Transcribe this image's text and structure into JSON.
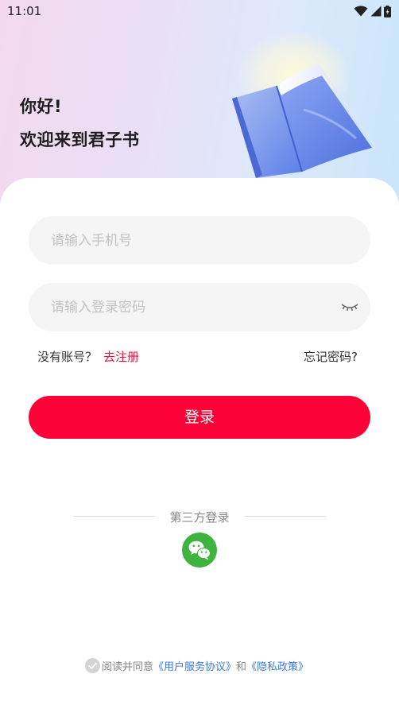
{
  "status_bar": {
    "time": "11:01",
    "icons": [
      "wifi-icon",
      "signal-icon",
      "battery-icon"
    ]
  },
  "header": {
    "greeting": "你好!",
    "welcome": "欢迎来到君子书",
    "illustration": "open-book-icon"
  },
  "form": {
    "phone_placeholder": "请输入手机号",
    "password_placeholder": "请输入登录密码",
    "password_toggle_icon": "eye-closed-icon",
    "no_account_text": "没有账号？",
    "register_link": "去注册",
    "forgot_password": "忘记密码?",
    "login_button": "登录"
  },
  "third_party": {
    "label": "第三方登录",
    "providers": [
      "wechat-icon"
    ]
  },
  "agreement": {
    "prefix": "阅读并同意",
    "user_agreement": "《用户服务协议》",
    "conjunction": "和",
    "privacy_policy": "《隐私政策》"
  },
  "colors": {
    "accent": "#fb0137",
    "link_red": "#e8113c",
    "link_blue": "#3b7be0",
    "wechat_green": "#3fb33f",
    "field_bg": "#f5f5f5"
  }
}
